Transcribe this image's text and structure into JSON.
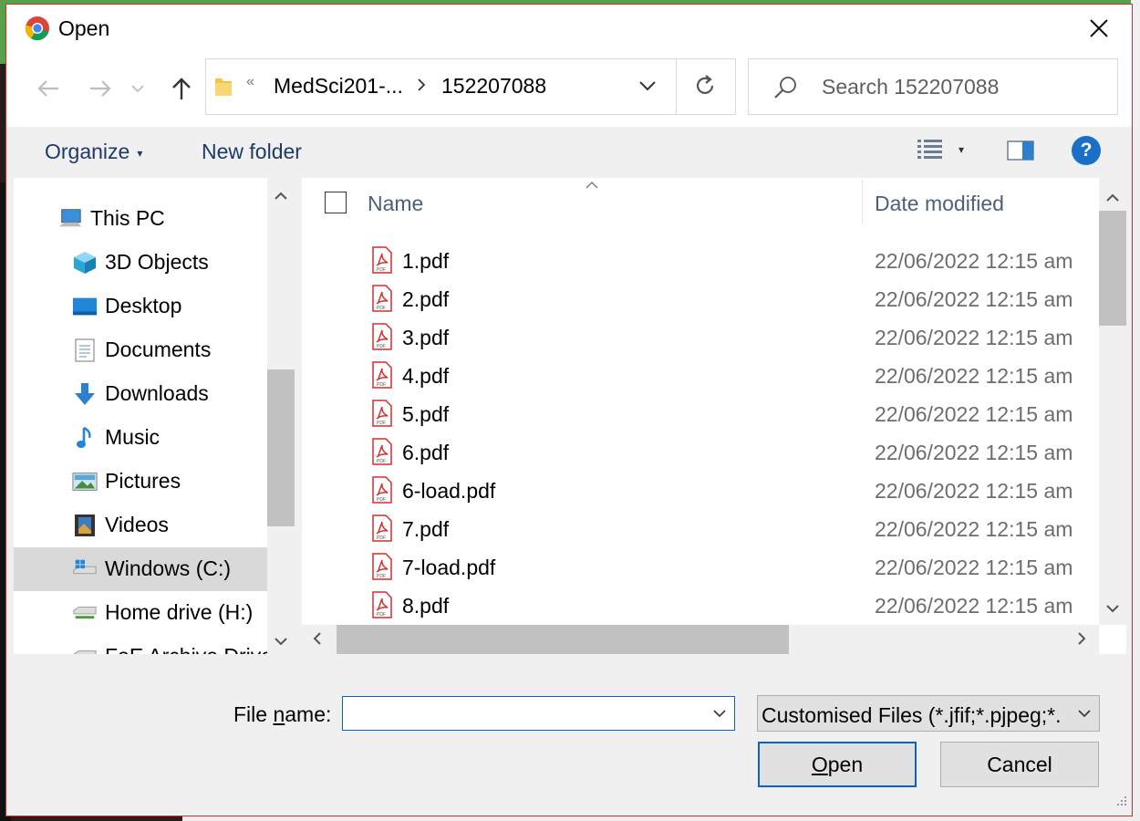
{
  "window": {
    "title": "Open"
  },
  "nav": {
    "back_icon": "back-arrow-icon",
    "forward_icon": "forward-arrow-icon",
    "recent_icon": "chevron-down-icon",
    "up_icon": "up-arrow-icon"
  },
  "address": {
    "overflow": "«",
    "segments": [
      "MedSci201-...",
      "152207088"
    ]
  },
  "search": {
    "placeholder": "Search 152207088"
  },
  "toolbar": {
    "organize": "Organize",
    "new_folder": "New folder",
    "help": "?"
  },
  "sidebar": {
    "items": [
      {
        "label": "This PC",
        "icon": "computer-icon"
      },
      {
        "label": "3D Objects",
        "icon": "3d-objects-icon"
      },
      {
        "label": "Desktop",
        "icon": "desktop-icon"
      },
      {
        "label": "Documents",
        "icon": "documents-icon"
      },
      {
        "label": "Downloads",
        "icon": "downloads-icon"
      },
      {
        "label": "Music",
        "icon": "music-icon"
      },
      {
        "label": "Pictures",
        "icon": "pictures-icon"
      },
      {
        "label": "Videos",
        "icon": "videos-icon"
      },
      {
        "label": "Windows (C:)",
        "icon": "drive-icon",
        "selected": true
      },
      {
        "label": "Home drive (H:)",
        "icon": "network-drive-icon"
      },
      {
        "label": "FoE Archive Drive",
        "icon": "network-drive-icon"
      }
    ]
  },
  "file_list": {
    "columns": {
      "name": "Name",
      "date_modified": "Date modified"
    },
    "rows": [
      {
        "name": "1.pdf",
        "date": "22/06/2022 12:15 am"
      },
      {
        "name": "2.pdf",
        "date": "22/06/2022 12:15 am"
      },
      {
        "name": "3.pdf",
        "date": "22/06/2022 12:15 am"
      },
      {
        "name": "4.pdf",
        "date": "22/06/2022 12:15 am"
      },
      {
        "name": "5.pdf",
        "date": "22/06/2022 12:15 am"
      },
      {
        "name": "6.pdf",
        "date": "22/06/2022 12:15 am"
      },
      {
        "name": "6-load.pdf",
        "date": "22/06/2022 12:15 am"
      },
      {
        "name": "7.pdf",
        "date": "22/06/2022 12:15 am"
      },
      {
        "name": "7-load.pdf",
        "date": "22/06/2022 12:15 am"
      },
      {
        "name": "8.pdf",
        "date": "22/06/2022 12:15 am"
      }
    ]
  },
  "footer": {
    "file_name_label_pre": "File ",
    "file_name_label_mnemonic": "n",
    "file_name_label_post": "ame:",
    "file_name_value": "",
    "file_type": "Customised Files (*.jfif;*.pjpeg;*.",
    "open_mnemonic": "O",
    "open_rest": "pen",
    "cancel": "Cancel"
  }
}
